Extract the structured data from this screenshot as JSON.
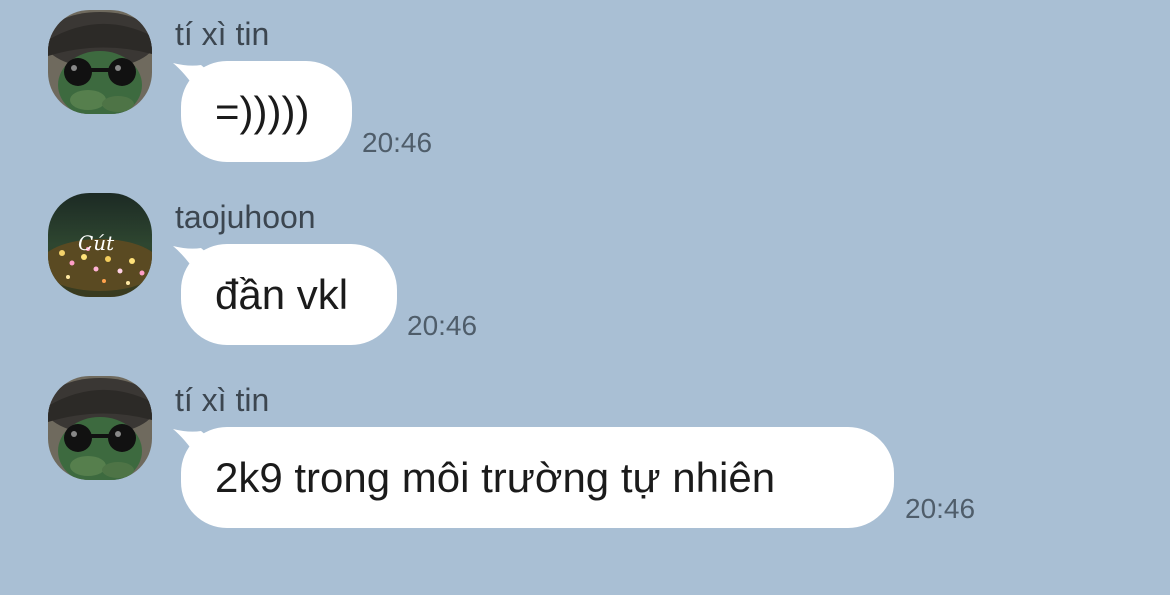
{
  "theme": {
    "background": "#a9bfd4",
    "bubble": "#ffffff"
  },
  "messages": [
    {
      "sender": "tí xì tin",
      "text": "=)))))",
      "time": "20:46",
      "avatar_icon": "turtle-with-sunglasses-avatar"
    },
    {
      "sender": "taojuhoon",
      "text": "đần vkl",
      "time": "20:46",
      "avatar_icon": "night-flowers-avatar",
      "avatar_caption": "Cút"
    },
    {
      "sender": "tí xì tin",
      "text": "2k9 trong môi trường tự nhiên",
      "time": "20:46",
      "avatar_icon": "turtle-with-sunglasses-avatar"
    }
  ]
}
